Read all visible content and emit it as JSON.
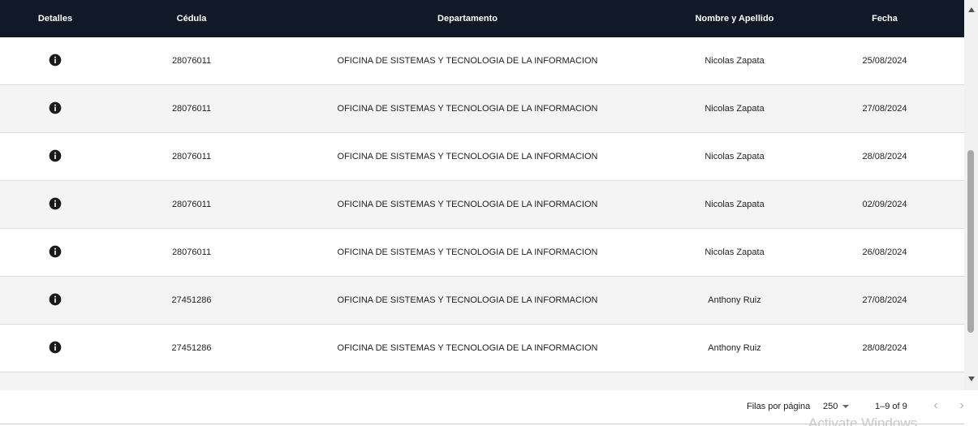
{
  "table": {
    "columns": [
      "Detalles",
      "Cédula",
      "Departamento",
      "Nombre y Apellido",
      "Fecha"
    ],
    "rows": [
      {
        "cedula": "28076011",
        "departamento": "OFICINA DE SISTEMAS Y TECNOLOGIA DE LA INFORMACION",
        "nombre": "Nicolas Zapata",
        "fecha": "25/08/2024"
      },
      {
        "cedula": "28076011",
        "departamento": "OFICINA DE SISTEMAS Y TECNOLOGIA DE LA INFORMACION",
        "nombre": "Nicolas Zapata",
        "fecha": "27/08/2024"
      },
      {
        "cedula": "28076011",
        "departamento": "OFICINA DE SISTEMAS Y TECNOLOGIA DE LA INFORMACION",
        "nombre": "Nicolas Zapata",
        "fecha": "28/08/2024"
      },
      {
        "cedula": "28076011",
        "departamento": "OFICINA DE SISTEMAS Y TECNOLOGIA DE LA INFORMACION",
        "nombre": "Nicolas Zapata",
        "fecha": "02/09/2024"
      },
      {
        "cedula": "28076011",
        "departamento": "OFICINA DE SISTEMAS Y TECNOLOGIA DE LA INFORMACION",
        "nombre": "Nicolas Zapata",
        "fecha": "26/08/2024"
      },
      {
        "cedula": "27451286",
        "departamento": "OFICINA DE SISTEMAS Y TECNOLOGIA DE LA INFORMACION",
        "nombre": "Anthony Ruiz",
        "fecha": "27/08/2024"
      },
      {
        "cedula": "27451286",
        "departamento": "OFICINA DE SISTEMAS Y TECNOLOGIA DE LA INFORMACION",
        "nombre": "Anthony Ruiz",
        "fecha": "28/08/2024"
      }
    ],
    "details_icon": "info-icon"
  },
  "pagination": {
    "rows_per_page_label": "Filas por página",
    "rows_per_page_value": "250",
    "range": "1–9 of 9",
    "prev_icon": "chevron-left-icon",
    "next_icon": "chevron-right-icon"
  },
  "overlay": {
    "watermark": "Activate Windows"
  },
  "colors": {
    "header_bg": "#111827",
    "row_alt_bg": "#f4f4f4"
  }
}
